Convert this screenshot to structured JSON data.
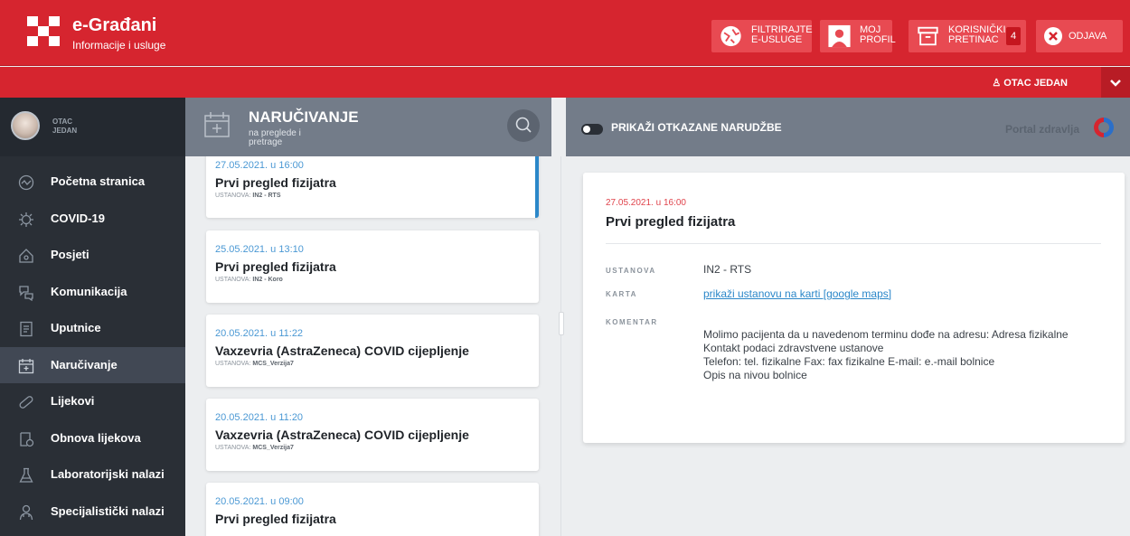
{
  "header": {
    "brand_title": "e-Građani",
    "brand_subtitle": "Informacije i usluge",
    "buttons": {
      "filter": [
        "FILTRIRAJTE",
        "E-USLUGE"
      ],
      "profile": [
        "MOJ",
        "PROFIL"
      ],
      "inbox": [
        "KORISNIČKI",
        "PRETINAC"
      ],
      "inbox_count": "4",
      "logout": "ODJAVA"
    },
    "user_name": "OTAC JEDAN"
  },
  "sidebar": {
    "avatar_name": [
      "OTAC",
      "JEDAN"
    ],
    "items": [
      {
        "label": "Početna stranica",
        "icon": "speedometer-icon"
      },
      {
        "label": "COVID-19",
        "icon": "virus-icon"
      },
      {
        "label": "Posjeti",
        "icon": "home-icon"
      },
      {
        "label": "Komunikacija",
        "icon": "chat-icon"
      },
      {
        "label": "Uputnice",
        "icon": "document-icon"
      },
      {
        "label": "Naručivanje",
        "icon": "calendar-icon"
      },
      {
        "label": "Lijekovi",
        "icon": "pill-icon"
      },
      {
        "label": "Obnova lijekova",
        "icon": "prescription-icon"
      },
      {
        "label": "Laboratorijski nalazi",
        "icon": "flask-icon"
      },
      {
        "label": "Specijalistički nalazi",
        "icon": "doctor-icon"
      }
    ]
  },
  "middle": {
    "title": "NARUČIVANJE",
    "subtitle": [
      "na preglede i",
      "pretrage"
    ],
    "appointments": [
      {
        "date": "27.05.2021. u 16:00",
        "title": "Prvi pregled fizijatra",
        "inst_label": "USTANOVA:",
        "inst": "IN2 - RTS"
      },
      {
        "date": "25.05.2021. u 13:10",
        "title": "Prvi pregled fizijatra",
        "inst_label": "USTANOVA:",
        "inst": "IN2 - Koro"
      },
      {
        "date": "20.05.2021. u 11:22",
        "title": "Vaxzevria (AstraZeneca) COVID cijepljenje",
        "inst_label": "USTANOVA:",
        "inst": "MCS_Verzija7"
      },
      {
        "date": "20.05.2021. u 11:20",
        "title": "Vaxzevria (AstraZeneca) COVID cijepljenje",
        "inst_label": "USTANOVA:",
        "inst": "MCS_Verzija7"
      },
      {
        "date": "20.05.2021. u 09:00",
        "title": "Prvi pregled fizijatra",
        "inst_label": "",
        "inst": ""
      }
    ]
  },
  "right": {
    "toggle_label": "PRIKAŽI OTKAZANE NARUDŽBE",
    "portal_label": "Portal zdravlja",
    "detail": {
      "date": "27.05.2021. u 16:00",
      "title": "Prvi pregled fizijatra",
      "inst_label": "USTANOVA",
      "inst": "IN2 - RTS",
      "map_label": "KARTA",
      "map_link": "prikaži ustanovu na karti [google maps]",
      "comment_label": "KOMENTAR",
      "comment_lines": [
        "Molimo pacijenta da u navedenom terminu dođe na adresu: Adresa fizikalne",
        "Kontakt podaci zdravstvene ustanove",
        "Telefon: tel. fizikalne Fax: fax fizikalne E-mail: e.-mail bolnice",
        "Opis na nivou bolnice"
      ]
    }
  }
}
